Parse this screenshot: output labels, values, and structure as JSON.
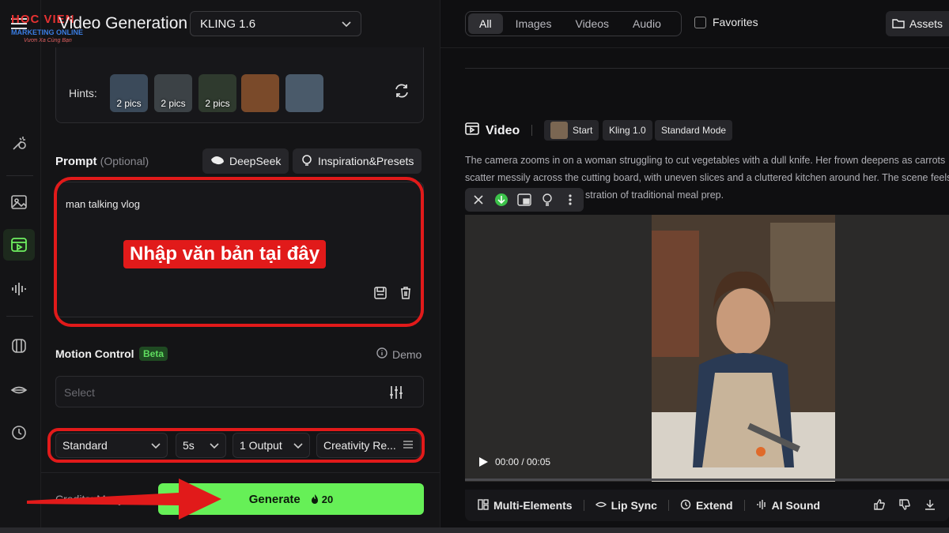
{
  "logo": {
    "mark": "HOC VIEN",
    "sub": "MARKETING ONLINE",
    "tag": "Vươn Xa Cùng Bạn"
  },
  "header": {
    "title": "Video Generation",
    "model": "KLING 1.6"
  },
  "hints": {
    "label": "Hints:",
    "items": [
      {
        "caption": "2 pics",
        "color": "#3b4a5a"
      },
      {
        "caption": "2 pics",
        "color": "#3c4246"
      },
      {
        "caption": "2 pics",
        "color": "#2f3a2e"
      },
      {
        "caption": "",
        "color": "#7a4a2a"
      },
      {
        "caption": "",
        "color": "#4a5a6a"
      }
    ]
  },
  "prompt": {
    "label": "Prompt",
    "optional": "(Optional)",
    "deepseek": "DeepSeek",
    "presets": "Inspiration&Presets",
    "value": "man talking vlog",
    "overlay": "Nhập văn bản tại đây"
  },
  "motion": {
    "label": "Motion Control",
    "badge": "Beta",
    "demo": "Demo",
    "placeholder": "Select"
  },
  "options": {
    "mode": "Standard",
    "duration": "5s",
    "outputs": "1 Output",
    "creativity": "Creativity Re..."
  },
  "footer": {
    "credits": "Credits: Many",
    "generate": "Generate",
    "cost": "20"
  },
  "right": {
    "tabs": [
      "All",
      "Images",
      "Videos",
      "Audio"
    ],
    "active_tab": "All",
    "favorites": "Favorites",
    "assets": "Assets",
    "video_title": "Video",
    "chips": [
      "Start",
      "Kling 1.0",
      "Standard Mode"
    ],
    "description_lines": [
      "The camera zooms in on a woman struggling to cut vegetables with a dull knife. Her frown deepens as carrots",
      "scatter messily across the cutting board, with uneven slices and a cluttered kitchen around her. The scene feels",
      "stration of traditional meal prep."
    ],
    "time": "00:00 / 00:05",
    "tools": [
      "Multi-Elements",
      "Lip Sync",
      "Extend",
      "AI Sound"
    ]
  }
}
